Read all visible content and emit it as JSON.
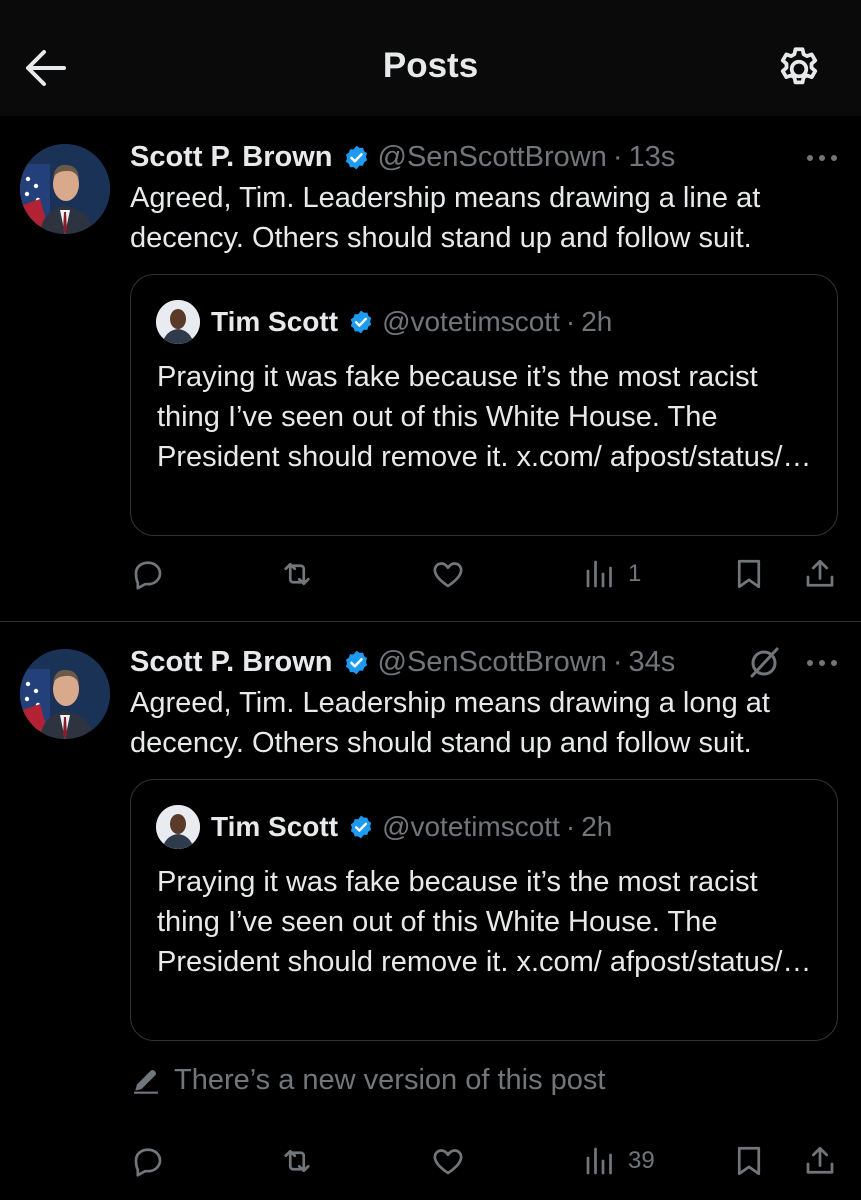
{
  "header": {
    "title": "Posts"
  },
  "posts": [
    {
      "author_name": "Scott P. Brown",
      "handle": "@SenScottBrown",
      "separator": "·",
      "time": "13s",
      "text": "Agreed, Tim. Leadership means drawing a line at decency. Others should stand up and follow suit.",
      "quote": {
        "author_name": "Tim Scott",
        "handle": "@votetimscott",
        "separator": "·",
        "time": "2h",
        "text": "Praying it was fake because it’s the most racist thing I’ve seen out of this White House. The President should remove it. x.com/ afpost/status/…"
      },
      "views": "1"
    },
    {
      "author_name": "Scott P. Brown",
      "handle": "@SenScottBrown",
      "separator": "·",
      "time": "34s",
      "text": "Agreed, Tim. Leadership means drawing a long at decency. Others should stand up and follow suit.",
      "quote": {
        "author_name": "Tim Scott",
        "handle": "@votetimscott",
        "separator": "·",
        "time": "2h",
        "text": "Praying it was fake because it’s the most racist thing I’ve seen out of this White House. The President should remove it. x.com/ afpost/status/…"
      },
      "edited_notice": "There’s a new version of this post",
      "views": "39"
    }
  ],
  "colors": {
    "background": "#000000",
    "text": "#e7e9ea",
    "muted": "#71767b",
    "verified": "#1d9bf0",
    "border": "#2f3336"
  },
  "icons": [
    "back-arrow-icon",
    "gear-icon",
    "verified-badge-icon",
    "more-icon",
    "edit-history-icon",
    "reply-icon",
    "repost-icon",
    "like-icon",
    "views-icon",
    "bookmark-icon",
    "share-icon",
    "pencil-icon"
  ]
}
